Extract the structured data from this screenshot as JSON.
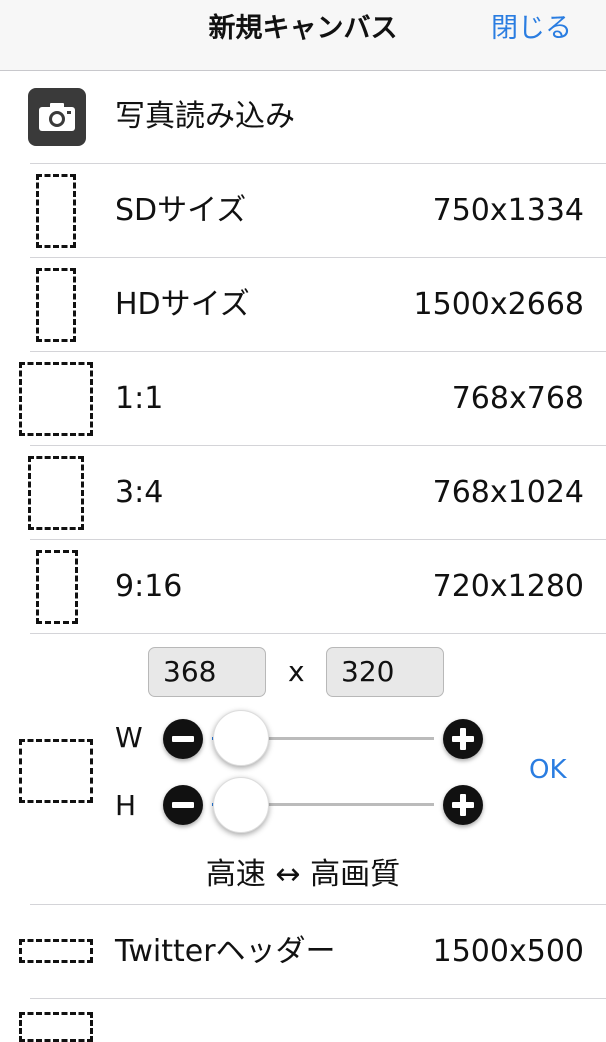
{
  "header": {
    "title": "新規キャンバス",
    "close_label": "閉じる"
  },
  "rows": [
    {
      "label": "写真読み込み",
      "value": "",
      "icon": "camera-icon"
    },
    {
      "label": "SDサイズ",
      "value": "750x1334",
      "icon": "dashed-portrait-icon"
    },
    {
      "label": "HDサイズ",
      "value": "1500x2668",
      "icon": "dashed-portrait-icon"
    },
    {
      "label": "1:1",
      "value": "768x768",
      "icon": "dashed-square-icon"
    },
    {
      "label": "3:4",
      "value": "768x1024",
      "icon": "dashed-portrait-icon"
    },
    {
      "label": "9:16",
      "value": "720x1280",
      "icon": "dashed-portrait-icon"
    }
  ],
  "custom": {
    "width_value": "368",
    "height_value": "320",
    "separator": "x",
    "w_label": "W",
    "h_label": "H",
    "ok_label": "OK",
    "quality_label": "高速 ↔ 高画質",
    "w_slider_level": 0.08,
    "h_slider_level": 0.08
  },
  "bottom_rows": [
    {
      "label": "Twitterヘッダー",
      "value": "1500x500",
      "icon": "dashed-landscape-icon"
    }
  ],
  "colors": {
    "accent": "#2a7de1",
    "navbar_bg": "#f7f7f7",
    "separator": "#d4d4d8"
  }
}
